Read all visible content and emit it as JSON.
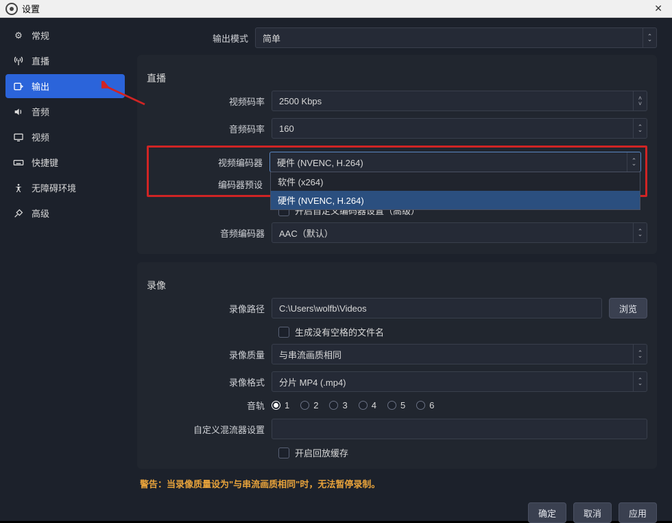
{
  "window": {
    "title": "设置"
  },
  "sidebar": {
    "items": [
      {
        "label": "常规",
        "icon": "gear-icon"
      },
      {
        "label": "直播",
        "icon": "antenna-icon"
      },
      {
        "label": "输出",
        "icon": "output-icon"
      },
      {
        "label": "音频",
        "icon": "speaker-icon"
      },
      {
        "label": "视频",
        "icon": "monitor-icon"
      },
      {
        "label": "快捷键",
        "icon": "keyboard-icon"
      },
      {
        "label": "无障碍环境",
        "icon": "accessibility-icon"
      },
      {
        "label": "高级",
        "icon": "tools-icon"
      }
    ]
  },
  "output_mode": {
    "label": "输出模式",
    "value": "简单"
  },
  "streaming": {
    "title": "直播",
    "video_bitrate": {
      "label": "视频码率",
      "value": "2500 Kbps"
    },
    "audio_bitrate": {
      "label": "音频码率",
      "value": "160"
    },
    "video_encoder": {
      "label": "视频编码器",
      "value": "硬件 (NVENC, H.264)",
      "options": [
        "软件 (x264)",
        "硬件 (NVENC, H.264)"
      ]
    },
    "encoder_preset": {
      "label": "编码器预设"
    },
    "custom_encoder_checkbox": "开启自定义编码器设置（高级）",
    "audio_encoder": {
      "label": "音频编码器",
      "value": "AAC（默认）"
    }
  },
  "recording": {
    "title": "录像",
    "path": {
      "label": "录像路径",
      "value": "C:\\Users\\wolfb\\Videos",
      "browse": "浏览"
    },
    "no_space_checkbox": "生成没有空格的文件名",
    "quality": {
      "label": "录像质量",
      "value": "与串流画质相同"
    },
    "format": {
      "label": "录像格式",
      "value": "分片 MP4 (.mp4)"
    },
    "tracks": {
      "label": "音轨",
      "options": [
        "1",
        "2",
        "3",
        "4",
        "5",
        "6"
      ],
      "selected": "1"
    },
    "muxer": {
      "label": "自定义混流器设置",
      "value": ""
    },
    "replay_buffer_checkbox": "开启回放缓存"
  },
  "warning": "警告：当录像质量设为\"与串流画质相同\"时，无法暂停录制。",
  "buttons": {
    "ok": "确定",
    "cancel": "取消",
    "apply": "应用"
  }
}
